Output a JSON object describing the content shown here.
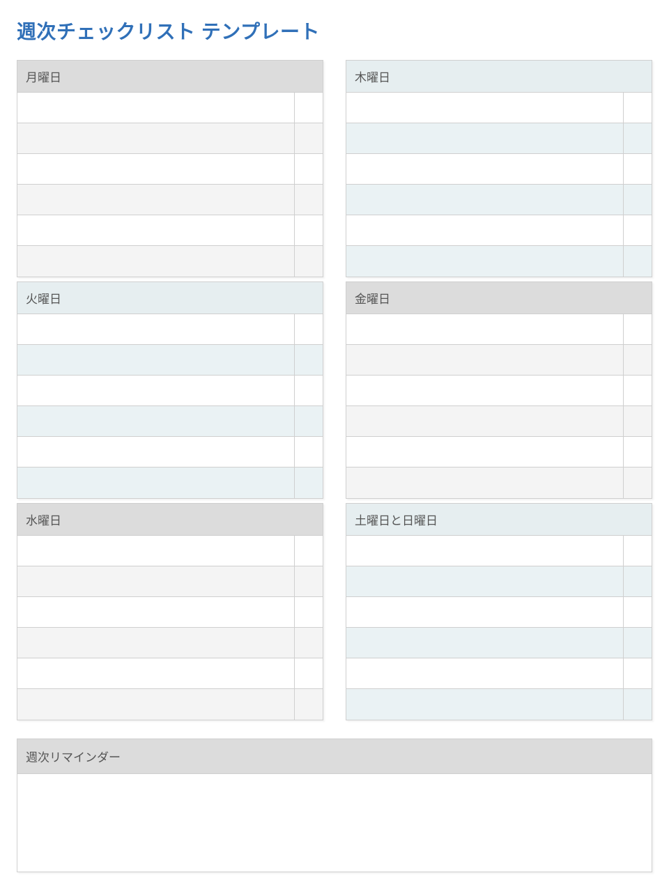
{
  "title": "週次チェックリスト テンプレート",
  "left_days": [
    {
      "label": "月曜日",
      "header_style": "hdr-gray",
      "alt_style": "band-gray-alt"
    },
    {
      "label": "火曜日",
      "header_style": "hdr-ice",
      "alt_style": "band-ice-alt"
    },
    {
      "label": "水曜日",
      "header_style": "hdr-gray",
      "alt_style": "band-gray-alt"
    }
  ],
  "right_days": [
    {
      "label": "木曜日",
      "header_style": "hdr-ice",
      "alt_style": "band-ice-alt"
    },
    {
      "label": "金曜日",
      "header_style": "hdr-gray",
      "alt_style": "band-gray-alt"
    },
    {
      "label": "土曜日と日曜日",
      "header_style": "hdr-ice",
      "alt_style": "band-ice-alt"
    }
  ],
  "rows_per_day": 6,
  "reminder_label": "週次リマインダー"
}
